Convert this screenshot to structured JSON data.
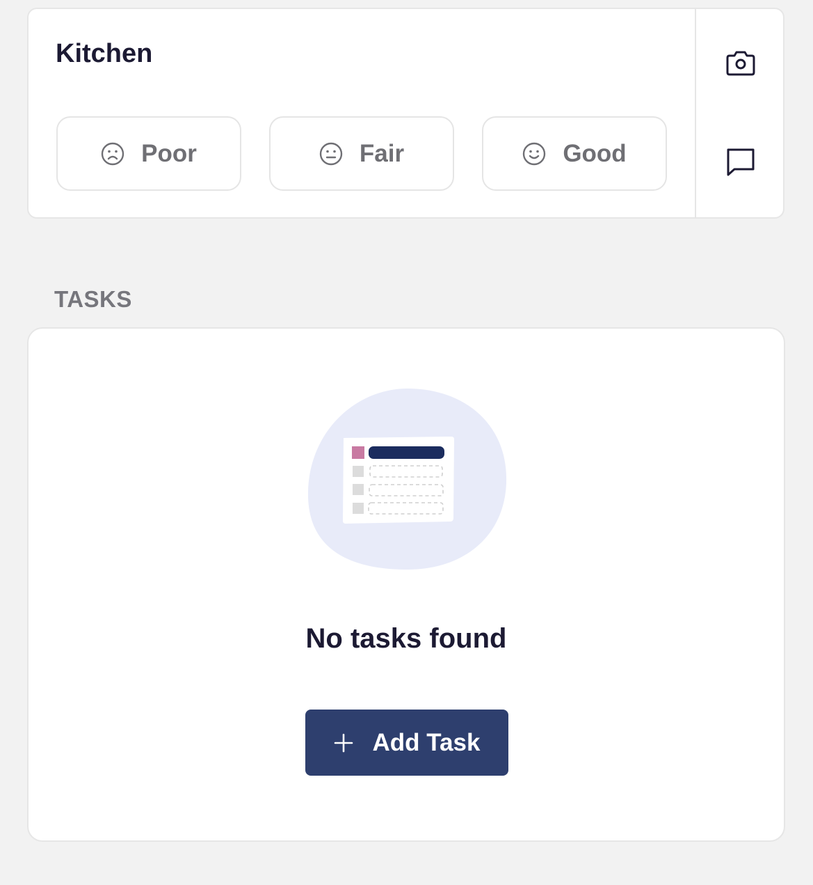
{
  "room": {
    "title": "Kitchen",
    "ratings": [
      {
        "label": "Poor",
        "icon": "frown-face-icon"
      },
      {
        "label": "Fair",
        "icon": "neutral-face-icon"
      },
      {
        "label": "Good",
        "icon": "smile-face-icon"
      }
    ],
    "actions": [
      {
        "icon": "camera-icon"
      },
      {
        "icon": "comment-icon"
      }
    ]
  },
  "tasks": {
    "section_label": "TASKS",
    "empty_message": "No tasks found",
    "add_button_label": "Add Task",
    "add_button_icon": "plus-icon"
  },
  "colors": {
    "background": "#f2f2f2",
    "card": "#ffffff",
    "primary_button": "#2e3f6e",
    "title_text": "#1c1a33",
    "muted_text": "#76767c",
    "illustration_blob": "#e8ebf9",
    "illustration_accent": "#c87aa2",
    "illustration_header": "#1b2c5e"
  }
}
